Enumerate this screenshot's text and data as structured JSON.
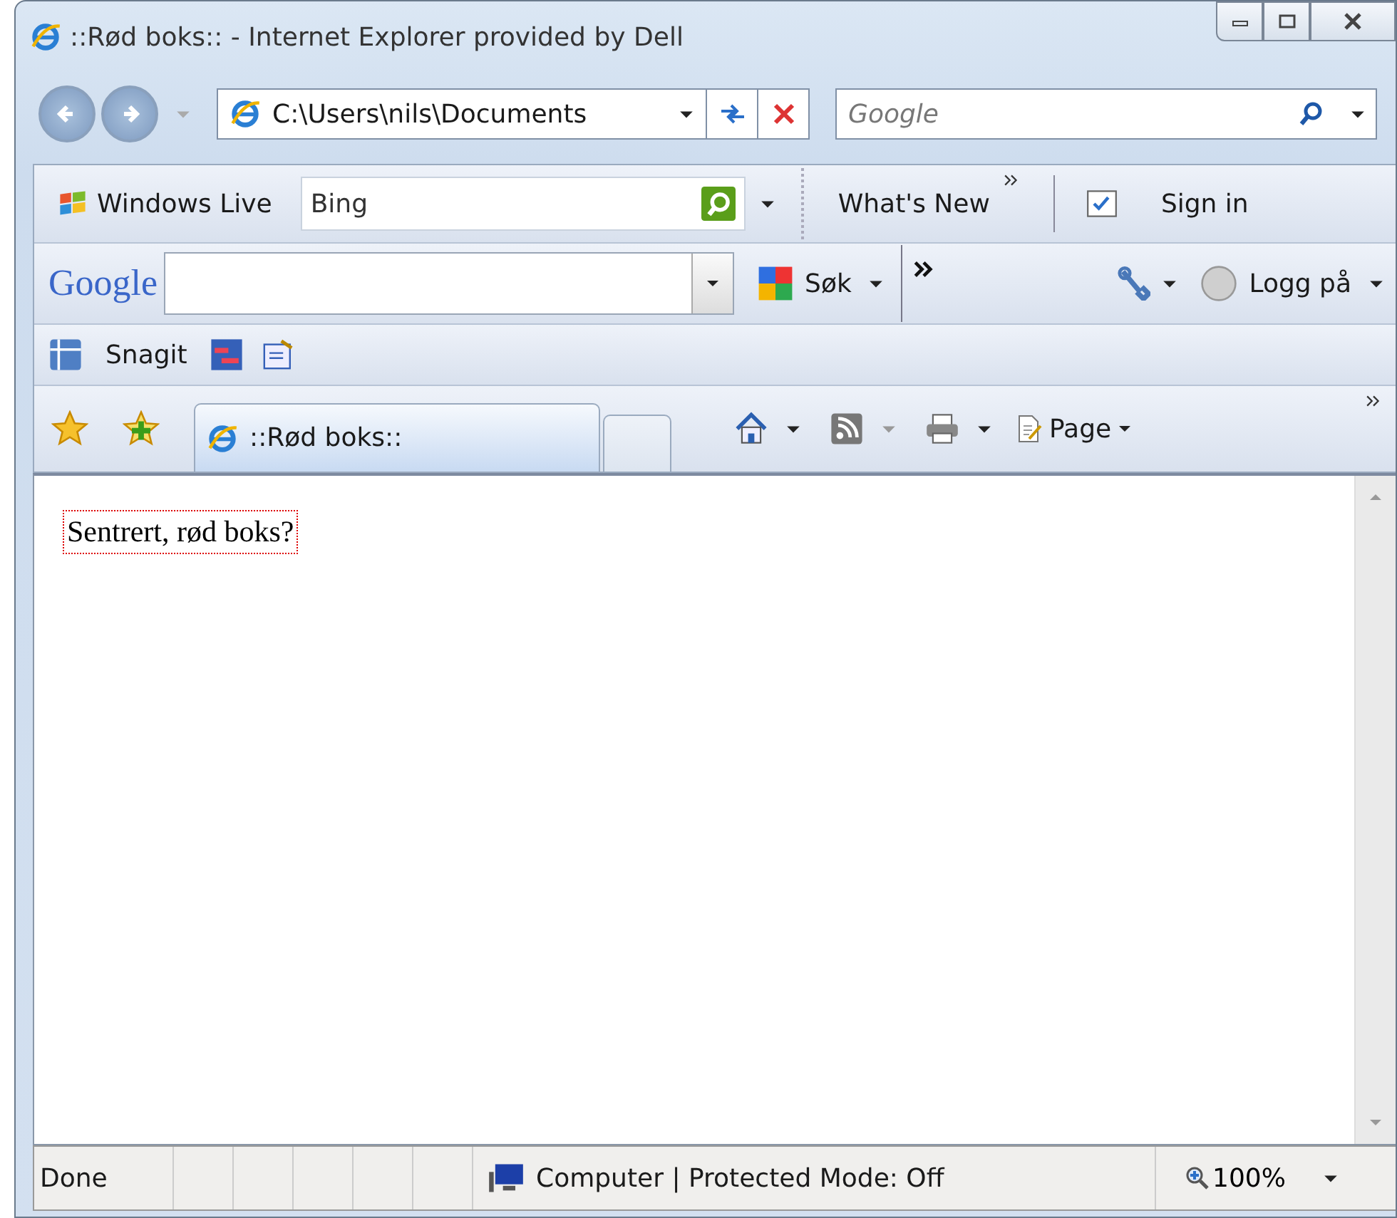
{
  "window": {
    "title": "::Rød boks:: - Internet Explorer provided by Dell"
  },
  "address_bar": {
    "value": "C:\\Users\\nils\\Documents"
  },
  "search_box": {
    "placeholder": "Google"
  },
  "windows_live_bar": {
    "brand": "Windows Live",
    "search_value": "Bing",
    "links": [
      "What's New",
      "Sign in"
    ]
  },
  "google_bar": {
    "logo": "Google",
    "search_button": "Søk",
    "sign_in": "Logg på"
  },
  "links_bar": {
    "items": [
      "Snagit"
    ]
  },
  "tabs": [
    {
      "label": "::Rød boks::",
      "selected": true
    }
  ],
  "command_bar": {
    "page_menu": "Page"
  },
  "page": {
    "text": "Sentrert, rød boks?"
  },
  "status_bar": {
    "status": "Done",
    "zone": "Computer | Protected Mode: Off",
    "zoom": "100%"
  }
}
